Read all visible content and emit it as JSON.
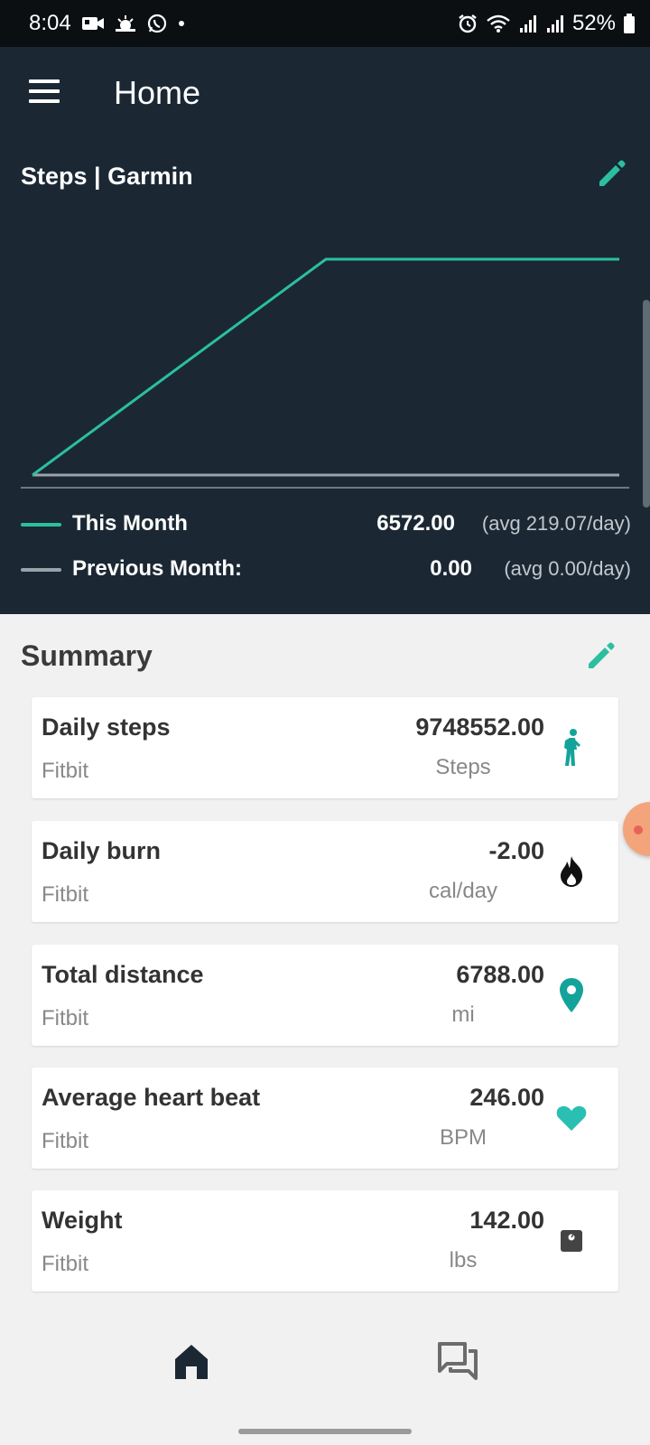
{
  "status_bar": {
    "time": "8:04",
    "battery": "52%",
    "left_icons": [
      "video-icon",
      "weather-icon",
      "whatsapp-icon",
      "dot-icon"
    ],
    "right_icons": [
      "alarm-icon",
      "wifi-icon",
      "signal-icon",
      "signal-icon",
      "battery-icon"
    ]
  },
  "app_bar": {
    "title": "Home"
  },
  "chart_card": {
    "title": "Steps | Garmin",
    "colors": {
      "this_month": "#2bbfa0",
      "previous_month": "#9aa3aa",
      "background": "#1b2834"
    },
    "legend": [
      {
        "label": "This Month",
        "value": "6572.00",
        "avg": "(avg 219.07/day)"
      },
      {
        "label": "Previous Month:",
        "value": "0.00",
        "avg": "(avg 0.00/day)"
      }
    ]
  },
  "chart_data": {
    "type": "line",
    "title": "Steps | Garmin",
    "xlabel": "",
    "ylabel": "",
    "grid": false,
    "legend": "bottom",
    "series": [
      {
        "name": "This Month",
        "x": [
          0,
          1,
          2
        ],
        "y": [
          0,
          6572,
          6572
        ]
      },
      {
        "name": "Previous Month:",
        "x": [
          0,
          2
        ],
        "y": [
          0,
          0
        ]
      }
    ],
    "ylim": [
      0,
      6572
    ],
    "xlim": [
      0,
      2
    ]
  },
  "summary": {
    "title": "Summary",
    "accent": "#2bbfa0",
    "items": [
      {
        "name": "Daily steps",
        "source": "Fitbit",
        "value": "9748552.00",
        "unit": "Steps",
        "icon": "walking-icon",
        "icon_color": "#14a39a"
      },
      {
        "name": "Daily burn",
        "source": "Fitbit",
        "value": "-2.00",
        "unit": "cal/day",
        "icon": "flame-icon",
        "icon_color": "#111111"
      },
      {
        "name": "Total distance",
        "source": "Fitbit",
        "value": "6788.00",
        "unit": "mi",
        "icon": "location-pin-icon",
        "icon_color": "#14a39a"
      },
      {
        "name": "Average heart beat",
        "source": "Fitbit",
        "value": "246.00",
        "unit": "BPM",
        "icon": "heart-icon",
        "icon_color": "#2bbfb3"
      },
      {
        "name": "Weight",
        "source": "Fitbit",
        "value": "142.00",
        "unit": "lbs",
        "icon": "scale-icon",
        "icon_color": "#444444"
      }
    ]
  },
  "bottom_nav": {
    "items": [
      "home-icon",
      "forum-icon"
    ]
  }
}
